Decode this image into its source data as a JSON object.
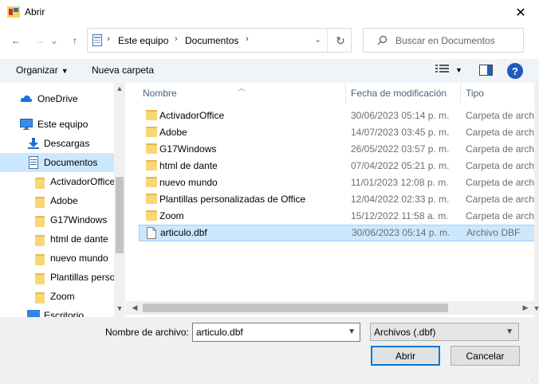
{
  "window": {
    "title": "Abrir",
    "close_glyph": "✕"
  },
  "nav": {
    "back_glyph": "←",
    "forward_glyph": "→",
    "history_glyph": "⌄",
    "up_glyph": "↑",
    "breadcrumb": [
      "Este equipo",
      "Documentos"
    ],
    "sep_glyph": "›",
    "refresh_glyph": "↻"
  },
  "search": {
    "placeholder": "Buscar en Documentos"
  },
  "toolbar": {
    "organize_label": "Organizar",
    "new_folder_label": "Nueva carpeta",
    "help_label": "?"
  },
  "sidebar": {
    "items": [
      {
        "label": "OneDrive",
        "icon": "cloud-icon"
      },
      {
        "label": "Este equipo",
        "icon": "computer-icon"
      },
      {
        "label": "Descargas",
        "icon": "download-icon"
      },
      {
        "label": "Documentos",
        "icon": "document-icon",
        "selected": true
      },
      {
        "label": "ActivadorOffice",
        "icon": "folder-icon"
      },
      {
        "label": "Adobe",
        "icon": "folder-icon"
      },
      {
        "label": "G17Windows",
        "icon": "folder-icon"
      },
      {
        "label": "html de dante",
        "icon": "folder-icon"
      },
      {
        "label": "nuevo mundo",
        "icon": "folder-icon"
      },
      {
        "label": "Plantillas personalizadas de Office",
        "icon": "folder-icon"
      },
      {
        "label": "Zoom",
        "icon": "folder-icon"
      },
      {
        "label": "Escritorio",
        "icon": "desktop-icon"
      }
    ]
  },
  "columns": {
    "name": "Nombre",
    "date": "Fecha de modificación",
    "type": "Tipo"
  },
  "files": [
    {
      "name": "ActivadorOffice",
      "date": "30/06/2023 05:14 p. m.",
      "type": "Carpeta de archivos",
      "kind": "folder"
    },
    {
      "name": "Adobe",
      "date": "14/07/2023 03:45 p. m.",
      "type": "Carpeta de archivos",
      "kind": "folder"
    },
    {
      "name": "G17Windows",
      "date": "26/05/2022 03:57 p. m.",
      "type": "Carpeta de archivos",
      "kind": "folder"
    },
    {
      "name": "html de dante",
      "date": "07/04/2022 05:21 p. m.",
      "type": "Carpeta de archivos",
      "kind": "folder"
    },
    {
      "name": "nuevo mundo",
      "date": "11/01/2023 12:08 p. m.",
      "type": "Carpeta de archivos",
      "kind": "folder"
    },
    {
      "name": "Plantillas personalizadas de Office",
      "date": "12/04/2022 02:33 p. m.",
      "type": "Carpeta de archivos",
      "kind": "folder"
    },
    {
      "name": "Zoom",
      "date": "15/12/2022 11:58 a. m.",
      "type": "Carpeta de archivos",
      "kind": "folder"
    },
    {
      "name": "articulo.dbf",
      "date": "30/06/2023 05:14 p. m.",
      "type": "Archivo DBF",
      "kind": "file",
      "selected": true
    }
  ],
  "footer": {
    "filename_label": "Nombre de archivo:",
    "filename_value": "articulo.dbf",
    "filter_value": "Archivos (.dbf)",
    "open_label": "Abrir",
    "cancel_label": "Cancelar"
  },
  "colors": {
    "accent": "#0078d7",
    "selection": "#cce8ff",
    "folder": "#f8d775"
  }
}
